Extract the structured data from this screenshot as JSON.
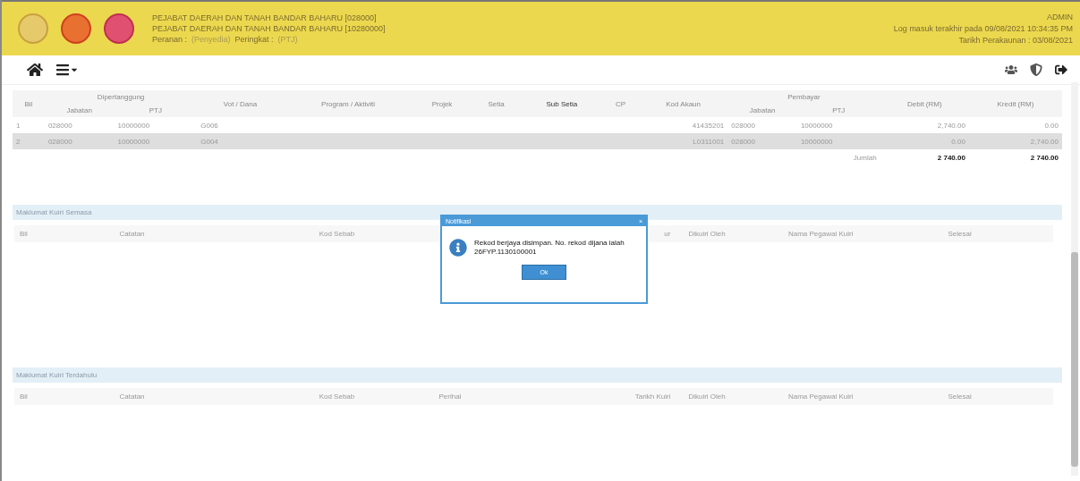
{
  "header": {
    "lines": [
      "PEJABAT DAERAH DAN TANAH BANDAR BAHARU [028000]",
      "PEJABAT DAERAH DAN TANAH BANDAR BAHARU [10280000]"
    ],
    "role_label": "Peranan :",
    "role_value": "(Penyedia)",
    "level_label": "Peringkat :",
    "level_value": "(PTJ)",
    "user": "ADMIN",
    "last_login": "Log masuk terakhir pada 09/08/2021 10:34:35 PM",
    "accounting_date": "Tarikh Perakaunan : 03/08/2021"
  },
  "table": {
    "columns": [
      {
        "label": "Bil"
      },
      {
        "label": "Dipertanggung",
        "colspan": 2,
        "children": [
          "Jabatan",
          "PTJ"
        ]
      },
      {
        "label": "Vot / Dana"
      },
      {
        "label": "Program / Aktiviti"
      },
      {
        "label": "Projek"
      },
      {
        "label": "Setia"
      },
      {
        "label": "Sub Setia"
      },
      {
        "label": "CP"
      },
      {
        "label": "Kod Akaun"
      },
      {
        "label": "Pembayar",
        "colspan": 2,
        "children": [
          "Jabatan",
          "PTJ"
        ]
      },
      {
        "label": "Debit (RM)"
      },
      {
        "label": "Kredit (RM)"
      }
    ],
    "rows": [
      {
        "selected": false,
        "cells": [
          "1",
          "028000",
          "10000000",
          "G006",
          "",
          "",
          "",
          "",
          "",
          "41435201",
          "028000",
          "10000000",
          "2,740.00",
          "0.00"
        ]
      },
      {
        "selected": true,
        "cells": [
          "2",
          "028000",
          "10000000",
          "G004",
          "",
          "",
          "",
          "",
          "",
          "L0311001",
          "028000",
          "10000000",
          "0.00",
          "2,740.00"
        ]
      }
    ],
    "total_label": "Jumlah",
    "total_debit": "2 740.00",
    "total_credit": "2 740.00"
  },
  "sections": [
    {
      "title": "Maklumat Kuiri Semasa",
      "columns": [
        "Bil",
        "Catatan",
        "Kod Sebab",
        null,
        "ur",
        "Dikuiri Oleh",
        "Nama Pegawai Kuiri",
        "Selesai"
      ]
    },
    {
      "title": "Maklumat Kuiri Terdahulu",
      "columns": [
        "Bil",
        "Catatan",
        "Kod Sebab",
        "Perihal",
        "Tarikh Kuiri",
        "Dikuiri Oleh",
        "Nama Pegawai Kuiri",
        "Selesai"
      ]
    }
  ],
  "dialog": {
    "title": "Notifikasi",
    "close": "×",
    "message": "Rekod berjaya disimpan. No. rekod dijana ialah 26FYP.1130100001",
    "button": "Ok"
  }
}
